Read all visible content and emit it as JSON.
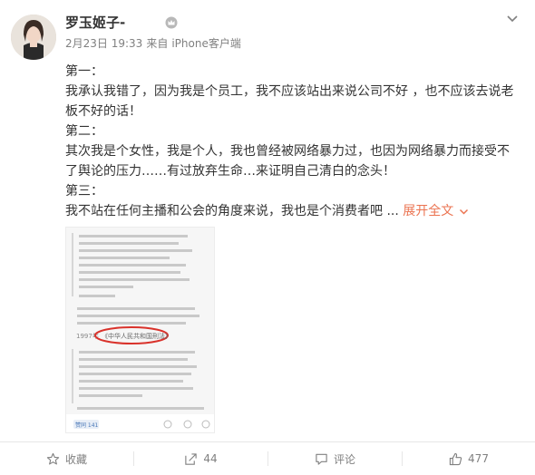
{
  "post": {
    "author": "罗玉姬子-",
    "time": "2月23日 19:33",
    "source_prefix": "来自",
    "source": "iPhone客户端",
    "lines": [
      "第一：",
      "我承认我错了，因为我是个员工，我不应该站出来说公司不好 ，也不应该去说老",
      "板不好的话！",
      "第二：",
      "其次我是个女性，我是个人，我也曾经被网络暴力过，也因为网络暴力而接受不",
      "了舆论的压力……有过放弃生命…来证明自己清白的念头！",
      "第三：",
      "我不站在任何主播和公会的角度来说，我也是个消费者吧 ..."
    ],
    "expand_label": "展开全文"
  },
  "image": {
    "highlight_text": "《中华人民共和国刑法》",
    "year_prefix": "1997年",
    "footer_count": "赞同 141"
  },
  "actions": {
    "favorite_label": "收藏",
    "repost_count": "44",
    "comment_label": "评论",
    "like_count": "477"
  },
  "colors": {
    "accent": "#eb7350",
    "meta": "#808080",
    "text": "#333333",
    "highlight_circle": "#d9322b"
  },
  "icons": {
    "vip": "vip-crown-icon",
    "menu": "chevron-down-icon",
    "favorite": "star-icon",
    "repost": "repost-icon",
    "comment": "comment-icon",
    "like": "thumbs-up-icon"
  }
}
